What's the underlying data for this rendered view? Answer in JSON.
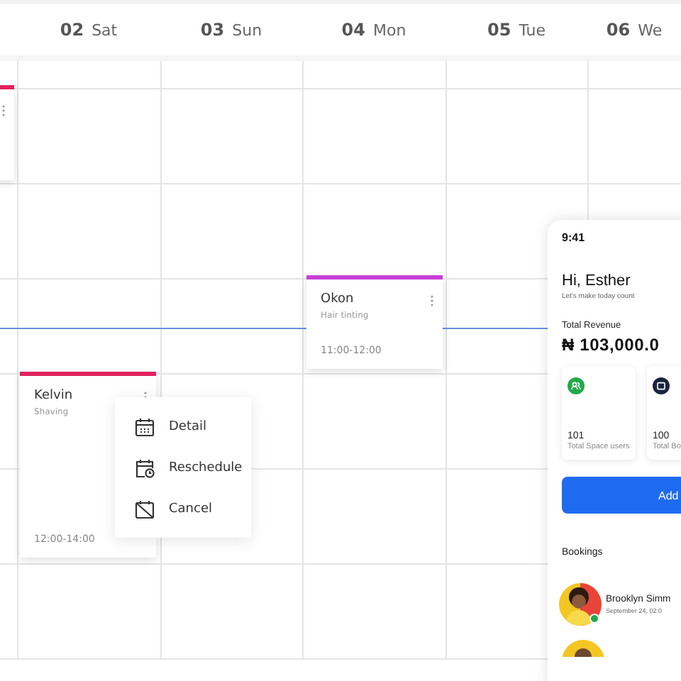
{
  "days": [
    {
      "num": "02",
      "name": "Sat"
    },
    {
      "num": "03",
      "name": "Sun"
    },
    {
      "num": "04",
      "name": "Mon"
    },
    {
      "num": "05",
      "name": "Tue"
    },
    {
      "num": "06",
      "name": "We"
    }
  ],
  "events": [
    {
      "color": "#e0245e"
    },
    {
      "name": "Okon",
      "service": "Hair tinting",
      "time": "11:00-12:00",
      "color": "#c63fd6"
    },
    {
      "name": "Kelvin",
      "service": "Shaving",
      "time": "12:00-14:00",
      "color": "#e0245e"
    }
  ],
  "menu": [
    {
      "kind": "detail",
      "label": "Detail"
    },
    {
      "kind": "reschedule",
      "label": "Reschedule"
    },
    {
      "kind": "cancel",
      "label": "Cancel"
    }
  ],
  "phone": {
    "time": "9:41",
    "greeting": "Hi, Esther",
    "subtitle": "Let's make today count",
    "revenue_label": "Total Revenue",
    "revenue": "₦ 103,000.0",
    "stats": [
      {
        "value": "101",
        "label": "Total Space users",
        "color": "#22a94b"
      },
      {
        "value": "100",
        "label": "Total Bo",
        "color": "#1b2540"
      }
    ],
    "button": "Add",
    "bookings_title": "Bookings",
    "bookings": [
      {
        "name": "Brooklyn Simm",
        "date": "September 24, 02:0"
      }
    ]
  }
}
